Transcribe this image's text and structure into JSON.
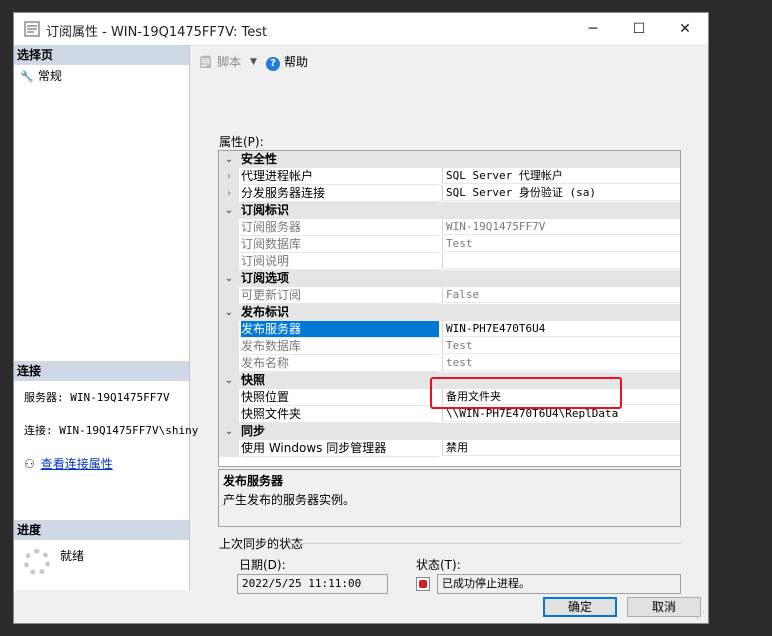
{
  "window": {
    "title": "订阅属性 - WIN-19Q1475FF7V: Test",
    "minimize_glyph": "─",
    "maximize_glyph": "☐",
    "close_glyph": "✕"
  },
  "sidebar": {
    "select_page_header": "选择页",
    "pages": [
      {
        "label": "常规",
        "icon": "wrench-icon"
      }
    ],
    "connection_header": "连接",
    "server_line": "服务器: WIN-19Q1475FF7V",
    "connection_line": "连接: WIN-19Q1475FF7V\\shiny",
    "view_connection_link": "查看连接属性",
    "progress_header": "进度",
    "progress_status": "就绪"
  },
  "toolbar": {
    "script_label": "脚本",
    "help_label": "帮助"
  },
  "properties": {
    "label": "属性(P):",
    "rows": [
      {
        "type": "category",
        "name": "安全性",
        "value": ""
      },
      {
        "type": "prop",
        "name": "代理进程帐户",
        "value": "SQL Server 代理帐户",
        "expandable": true
      },
      {
        "type": "prop",
        "name": "分发服务器连接",
        "value": "SQL Server 身份验证 (sa)",
        "expandable": true
      },
      {
        "type": "category",
        "name": "订阅标识",
        "value": ""
      },
      {
        "type": "readonly",
        "name": "订阅服务器",
        "value": "WIN-19Q1475FF7V"
      },
      {
        "type": "readonly",
        "name": "订阅数据库",
        "value": "Test"
      },
      {
        "type": "readonly",
        "name": "订阅说明",
        "value": ""
      },
      {
        "type": "category",
        "name": "订阅选项",
        "value": ""
      },
      {
        "type": "readonly",
        "name": "可更新订阅",
        "value": "False"
      },
      {
        "type": "category",
        "name": "发布标识",
        "value": ""
      },
      {
        "type": "selected",
        "name": "发布服务器",
        "value": "WIN-PH7E470T6U4"
      },
      {
        "type": "readonly",
        "name": "发布数据库",
        "value": "Test"
      },
      {
        "type": "readonly",
        "name": "发布名称",
        "value": "test"
      },
      {
        "type": "category",
        "name": "快照",
        "value": ""
      },
      {
        "type": "prop",
        "name": "快照位置",
        "value": "备用文件夹"
      },
      {
        "type": "prop",
        "name": "快照文件夹",
        "value": "\\\\WIN-PH7E470T6U4\\ReplData"
      },
      {
        "type": "category",
        "name": "同步",
        "value": ""
      },
      {
        "type": "prop",
        "name": "使用 Windows 同步管理器",
        "value": "禁用"
      }
    ]
  },
  "description": {
    "title": "发布服务器",
    "text": "产生发布的服务器实例。"
  },
  "sync": {
    "section_title": "上次同步的状态",
    "date_label": "日期(D):",
    "date_value": "2022/5/25 11:11:00",
    "status_label": "状态(T):",
    "status_value": "已成功停止进程。"
  },
  "buttons": {
    "ok": "确定",
    "cancel": "取消"
  },
  "colors": {
    "selection": "#0078d7",
    "highlight_box": "#e81123",
    "section_header": "#cfd8e6"
  }
}
